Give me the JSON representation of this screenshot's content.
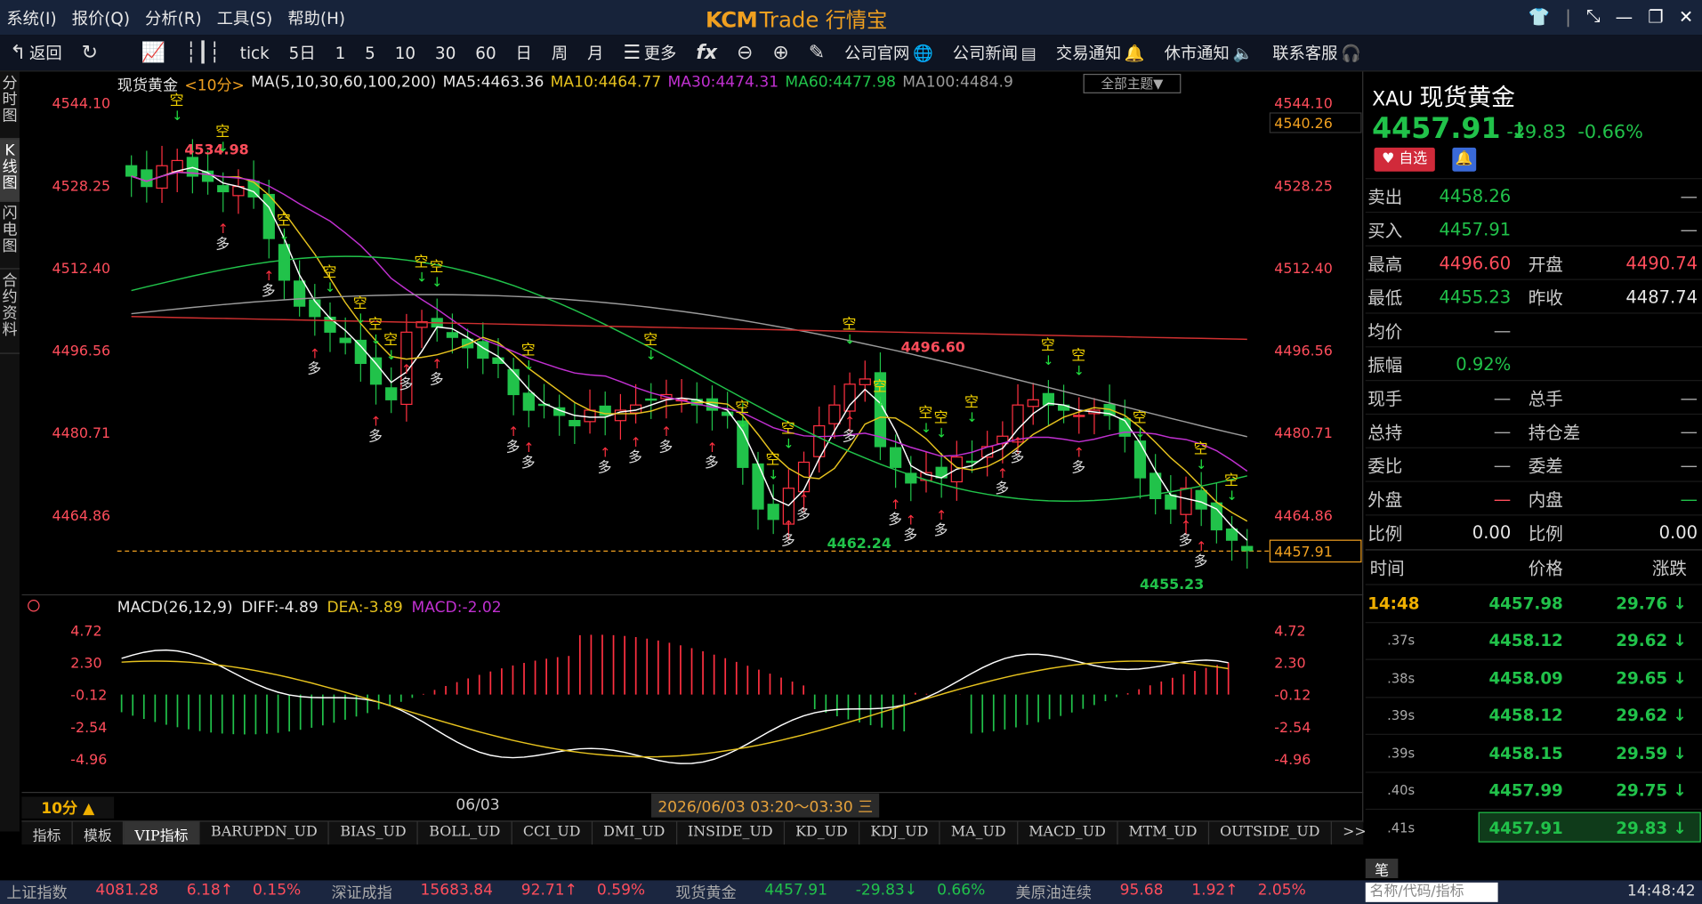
{
  "menu": [
    "系统(I)",
    "报价(Q)",
    "分析(R)",
    "工具(S)",
    "帮助(H)"
  ],
  "brand": {
    "logo": "KCM",
    "trade": "Trade",
    "cn": "行情宝"
  },
  "toolbar": {
    "back": "返回",
    "periods": [
      "tick",
      "5日",
      "1",
      "5",
      "10",
      "30",
      "60",
      "日",
      "周",
      "月"
    ],
    "more": "更多",
    "links": [
      "公司官网",
      "公司新闻",
      "交易通知",
      "休市通知",
      "联系客服"
    ]
  },
  "vtabs": [
    "分时图",
    "K线图",
    "闪电图",
    "合约资料"
  ],
  "legend": {
    "name": "现货黄金",
    "period": "<10分>",
    "ma": "MA(5,10,30,60,100,200)",
    "ma5": "MA5:4463.36",
    "ma10": "MA10:4464.77",
    "ma30": "MA30:4474.31",
    "ma60": "MA60:4477.98",
    "ma100": "MA100:4484.9",
    "theme": "全部主题▼"
  },
  "macd_legend": {
    "label": "MACD(26,12,9)",
    "diff": "DIFF:-4.89",
    "dea": "DEA:-3.89",
    "macd": "MACD:-2.02"
  },
  "chart_data": [
    {
      "type": "candlestick",
      "title": "现货黄金",
      "y_ticks": [
        "4544.10",
        "4528.25",
        "4512.40",
        "4496.56",
        "4480.71",
        "4464.86"
      ],
      "ylim": [
        4452,
        4548
      ],
      "annotations": [
        "4534.98",
        "4496.60",
        "4462.24",
        "4455.23"
      ],
      "current_price": "4457.91",
      "right_label_top": "4540.26",
      "x_label": "06/03",
      "ma_colors": {
        "ma5": "#ffffff",
        "ma10": "#e6c21e",
        "ma30": "#c030d0",
        "ma60": "#21c24a",
        "ma100": "#9a9a9a",
        "ma200": "#d03030"
      }
    },
    {
      "type": "bar",
      "title": "MACD",
      "y_ticks": [
        "4.72",
        "2.30",
        "-0.12",
        "-2.54",
        "-4.96"
      ],
      "ylim": [
        -6.5,
        5.5
      ]
    }
  ],
  "period_label": "10分 ▲",
  "range": "2026/06/03 03:20～03:30 三",
  "ind_tabs": [
    "指标",
    "模板",
    "VIP指标",
    "BARUPDN_UD",
    "BIAS_UD",
    "BOLL_UD",
    "CCI_UD",
    "DMI_UD",
    "INSIDE_UD",
    "KD_UD",
    "KDJ_UD",
    "MA_UD",
    "MACD_UD",
    "MTM_UD",
    "OUTSIDE_UD",
    ">>"
  ],
  "quote": {
    "sym": "XAU",
    "name": "现货黄金",
    "price": "4457.91",
    "arrow": "↓",
    "chg": "-29.83",
    "pct": "-0.66%",
    "fav": "♥ 自选",
    "rows": [
      {
        "l": "卖出",
        "v": "4458.26",
        "l2": "",
        "v2": "—"
      },
      {
        "l": "买入",
        "v": "4457.91",
        "l2": "",
        "v2": "—"
      },
      {
        "l": "最高",
        "v": "4496.60",
        "l2": "开盘",
        "v2": "4490.74"
      },
      {
        "l": "最低",
        "v": "4455.23",
        "l2": "昨收",
        "v2": "4487.74"
      },
      {
        "l": "均价",
        "v": "—",
        "l2": "",
        "v2": ""
      },
      {
        "l": "振幅",
        "v": "0.92%",
        "l2": "",
        "v2": ""
      },
      {
        "l": "现手",
        "v": "—",
        "l2": "总手",
        "v2": "—"
      },
      {
        "l": "总持",
        "v": "—",
        "l2": "持仓差",
        "v2": "—"
      },
      {
        "l": "委比",
        "v": "—",
        "l2": "委差",
        "v2": "—"
      },
      {
        "l": "外盘",
        "v": "—",
        "l2": "内盘",
        "v2": "—"
      },
      {
        "l": "比例",
        "v": "0.00",
        "l2": "比例",
        "v2": "0.00"
      }
    ],
    "tick_head": [
      "时间",
      "价格",
      "涨跌"
    ],
    "ticks": [
      {
        "t": "14:48",
        "p": "4457.98",
        "c": "29.76 ↓"
      },
      {
        "t": ".37s",
        "p": "4458.12",
        "c": "29.62 ↓"
      },
      {
        "t": ".38s",
        "p": "4458.09",
        "c": "29.65 ↓"
      },
      {
        "t": ".39s",
        "p": "4458.12",
        "c": "29.62 ↓"
      },
      {
        "t": ".39s",
        "p": "4458.15",
        "c": "29.59 ↓"
      },
      {
        "t": ".40s",
        "p": "4457.99",
        "c": "29.75 ↓"
      },
      {
        "t": ".41s",
        "p": "4457.91",
        "c": "29.83 ↓"
      }
    ],
    "pen": "笔"
  },
  "statusbar": {
    "items": [
      {
        "name": "上证指数",
        "v": "4081.28",
        "c": "6.18↑",
        "p": "0.15%",
        "color": "#ff4d5b"
      },
      {
        "name": "深证成指",
        "v": "15683.84",
        "c": "92.71↑",
        "p": "0.59%",
        "color": "#ff4d5b"
      },
      {
        "name": "现货黄金",
        "v": "4457.91",
        "c": "-29.83↓",
        "p": "0.66%",
        "color": "#21c24a"
      },
      {
        "name": "美原油连续",
        "v": "95.68",
        "c": "1.92↑",
        "p": "2.05%",
        "color": "#ff4d5b"
      }
    ],
    "search": "名称/代码/指标",
    "time": "14:48:42"
  }
}
